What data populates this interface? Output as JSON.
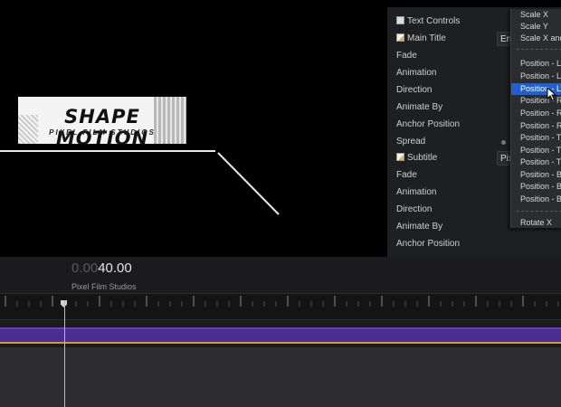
{
  "viewer": {
    "logo_title": "SHAPE MOTION",
    "logo_subtitle": "PIXEL FILM STUDIOS"
  },
  "inspector": {
    "rows": [
      {
        "label": "Text Controls",
        "icon": "checkbox-icon"
      },
      {
        "label": "Main Title",
        "icon": "note-icon",
        "value": "En"
      },
      {
        "label": "Fade"
      },
      {
        "label": "Animation"
      },
      {
        "label": "Direction"
      },
      {
        "label": "Animate By"
      },
      {
        "label": "Anchor Position"
      },
      {
        "label": "Spread"
      },
      {
        "label": "Subtitle",
        "icon": "note-icon",
        "value": "Pix"
      },
      {
        "label": "Fade"
      },
      {
        "label": "Animation"
      },
      {
        "label": "Direction"
      },
      {
        "label": "Animate By"
      },
      {
        "label": "Anchor Position"
      }
    ]
  },
  "dropdown": {
    "items": [
      "Scale X",
      "Scale Y",
      "Scale X and",
      "Position - L",
      "Position - L",
      "Position - L",
      "Position - R",
      "Position - R",
      "Position - R",
      "Position - T",
      "Position - T",
      "Position - T",
      "Position - B",
      "Position - B",
      "Position - B",
      "Rotate X"
    ],
    "selected_index": 5
  },
  "timeline": {
    "timecode_dim": "0.00",
    "timecode_bright": "40.00",
    "clip_label": "Pixel Film Studios"
  }
}
